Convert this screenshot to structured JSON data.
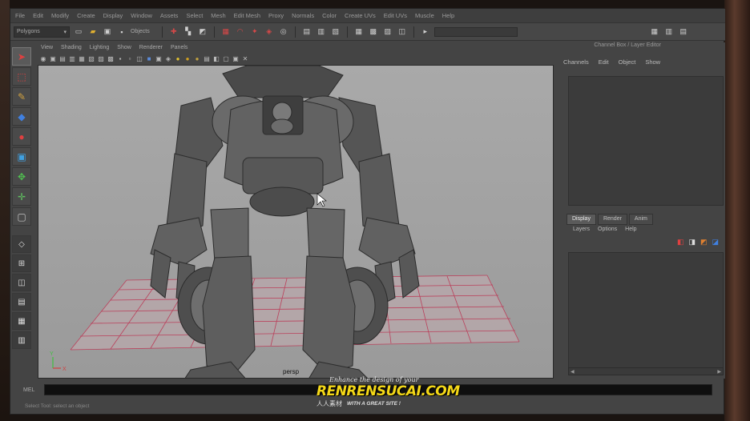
{
  "menubar": {
    "items": [
      "File",
      "Edit",
      "Modify",
      "Create",
      "Display",
      "Window",
      "Assets",
      "Select",
      "Mesh",
      "Edit Mesh",
      "Proxy",
      "Normals",
      "Color",
      "Create UVs",
      "Edit UVs",
      "Muscle",
      "Help"
    ]
  },
  "statusline": {
    "mode": "Polygons",
    "objects_label": "Objects"
  },
  "panel": {
    "menu": [
      "View",
      "Shading",
      "Lighting",
      "Show",
      "Renderer",
      "Panels"
    ],
    "camera_label": "persp",
    "grid_color": "#c03050",
    "viewport_bg": "#a3a3a3"
  },
  "channel_box": {
    "title": "Channel Box / Layer Editor",
    "menu": [
      "Channels",
      "Edit",
      "Object",
      "Show"
    ],
    "layer_tabs": [
      "Display",
      "Render",
      "Anim"
    ],
    "layer_menu": [
      "Layers",
      "Options",
      "Help"
    ]
  },
  "cmdline": {
    "label": "MEL"
  },
  "helpline": {
    "text": "Select Tool: select an object"
  },
  "watermark": {
    "top": "Enhance the design of your",
    "main": "RENRENSUCAI.COM",
    "cn": "人人素材",
    "slogan": "WITH A GREAT SITE !"
  },
  "colors": {
    "accent_red": "#d84848",
    "watermark_yellow": "#f4d818"
  }
}
